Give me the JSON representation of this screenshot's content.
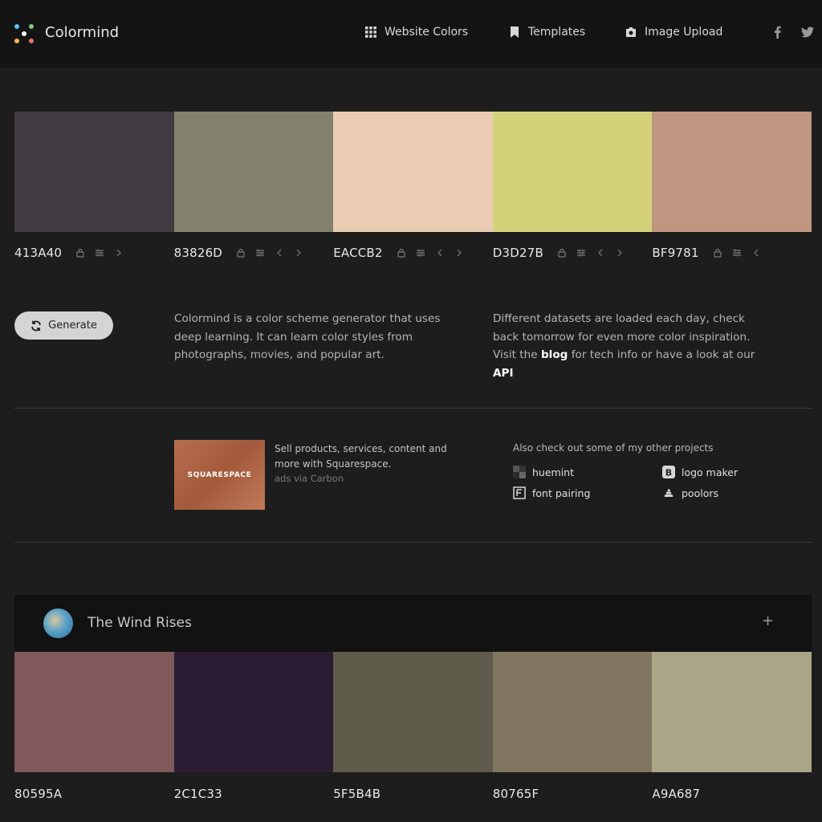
{
  "header": {
    "brand": "Colormind",
    "nav": [
      {
        "label": "Website Colors",
        "icon": "grid-icon"
      },
      {
        "label": "Templates",
        "icon": "bookmark-icon"
      },
      {
        "label": "Image Upload",
        "icon": "camera-icon"
      }
    ],
    "social": [
      "facebook-icon",
      "twitter-icon"
    ]
  },
  "palette": {
    "colors": [
      {
        "hex": "413A40",
        "color": "#413A40"
      },
      {
        "hex": "83826D",
        "color": "#83826D"
      },
      {
        "hex": "EACCB2",
        "color": "#EACCB2"
      },
      {
        "hex": "D3D27B",
        "color": "#D3D27B"
      },
      {
        "hex": "BF9781",
        "color": "#BF9781"
      }
    ]
  },
  "generate": {
    "label": "Generate"
  },
  "intro": {
    "left": "Colormind is a color scheme generator that uses deep learning. It can learn color styles from photographs, movies, and popular art.",
    "right_before": "Different datasets are loaded each day, check back tomorrow for even more color inspiration. Visit the",
    "blog_link": "blog",
    "right_middle": "for tech info or have a look at our",
    "api_link": "API"
  },
  "ad": {
    "logo_text": "SQUARESPACE",
    "text": "Sell products, services, content and more with Squarespace.",
    "via": "ads via Carbon"
  },
  "projects": {
    "title": "Also check out some of my other projects",
    "items": [
      {
        "label": "huemint",
        "icon": "huemint-icon"
      },
      {
        "label": "logo maker",
        "icon": "logo-maker-icon"
      },
      {
        "label": "font pairing",
        "icon": "font-pairing-icon"
      },
      {
        "label": "poolors",
        "icon": "poolors-icon"
      }
    ]
  },
  "card": {
    "title": "The Wind Rises",
    "plus": "+",
    "colors": [
      {
        "hex": "80595A",
        "color": "#80595A"
      },
      {
        "hex": "2C1C33",
        "color": "#2C1C33"
      },
      {
        "hex": "5F5B4B",
        "color": "#5F5B4B"
      },
      {
        "hex": "80765F",
        "color": "#80765F"
      },
      {
        "hex": "A9A687",
        "color": "#A9A687"
      }
    ]
  }
}
